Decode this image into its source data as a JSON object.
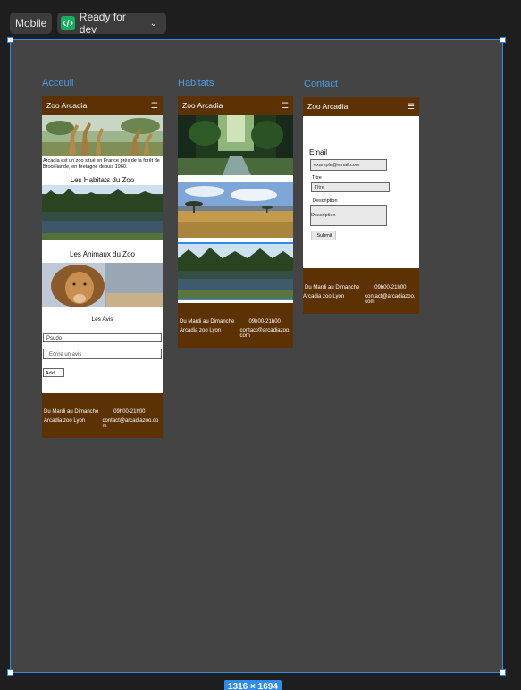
{
  "toolbar": {
    "mobile_label": "Mobile",
    "status_label": "Ready for dev"
  },
  "frame": {
    "size_label": "1316 × 1694"
  },
  "pages": {
    "accueil": {
      "label": "Acceuil",
      "header": "Zoo Arcadia",
      "intro": "Arcadia est un zoo situé en France près de la forêt de Brocéliande, en bretagne depuis 1960.",
      "habitats_title": "Les Habitats du Zoo",
      "animaux_title": "Les Animaux du Zoo",
      "avis_title": "Les Avis",
      "pseudo_placeholder": "Psudo",
      "avis_placeholder": "Ecrire un avis",
      "add_label": "Add",
      "footer_days": "Du Mardi au Dimanche",
      "footer_hours": "09h00-21h00",
      "footer_address": "Arcadia zoo Lyon",
      "footer_email": "contact@arcadiazoo.com"
    },
    "habitats": {
      "label": "Habitats",
      "header": "Zoo Arcadia",
      "footer_days": "Du Mardi au Dimanche",
      "footer_hours": "09h00-21h00",
      "footer_address": "Arcadia zoo Lyon",
      "footer_email": "contact@arcadiazoo.com"
    },
    "contact": {
      "label": "Contact",
      "header": "Zoo Arcadia",
      "email_label": "Email",
      "email_placeholder": "example@email.com",
      "titre_label": "Titre",
      "titre_placeholder": "Titre",
      "description_label": "Description",
      "description_placeholder": "Description",
      "submit_label": "Submit",
      "footer_days": "Du Mardi au Dimanche",
      "footer_hours": "09h00-21h00",
      "footer_address": "Arcadia zoo Lyon",
      "footer_email": "contact@arcadiazoo.com"
    }
  },
  "colors": {
    "brand_brown": "#5c3103",
    "selection_blue": "#2f8ceb",
    "status_green": "#14ae5c"
  }
}
